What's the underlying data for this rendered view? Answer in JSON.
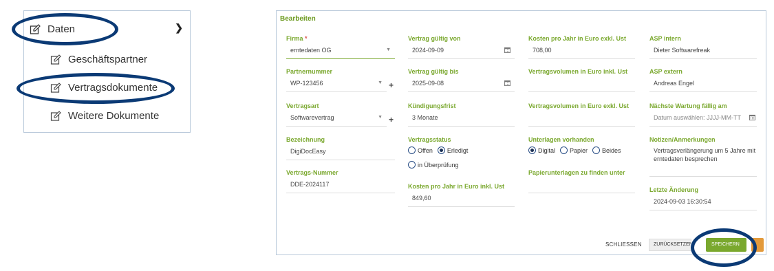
{
  "nav": {
    "top": "Daten",
    "items": [
      "Geschäftspartner",
      "Vertragsdokumente",
      "Weitere Dokumente"
    ]
  },
  "panel": {
    "title": "Bearbeiten",
    "col1": {
      "firma_label": "Firma",
      "firma_required": "*",
      "firma_value": "erntedaten OG",
      "partner_label": "Partnernummer",
      "partner_value": "WP-123456",
      "art_label": "Vertragsart",
      "art_value": "Softwarevertrag",
      "bez_label": "Bezeichnung",
      "bez_value": "DigiDocEasy",
      "nr_label": "Vertrags-Nummer",
      "nr_value": "DDE-2024117"
    },
    "col2": {
      "von_label": "Vertrag gültig von",
      "von_value": "2024-09-09",
      "bis_label": "Vertrag gültig bis",
      "bis_value": "2025-09-08",
      "kuend_label": "Kündigungsfrist",
      "kuend_value": "3 Monate",
      "status_label": "Vertragsstatus",
      "status_options": [
        "Offen",
        "Erledigt",
        "in Überprüfung"
      ],
      "status_selected": "Erledigt",
      "kosten_inkl_label": "Kosten pro Jahr in Euro inkl. Ust",
      "kosten_inkl_value": "849,60"
    },
    "col3": {
      "kosten_exkl_label": "Kosten pro Jahr in Euro exkl. Ust",
      "kosten_exkl_value": "708,00",
      "vol_inkl_label": "Vertragsvolumen in Euro inkl. Ust",
      "vol_exkl_label": "Vertragsvolumen in Euro exkl. Ust",
      "unterlagen_label": "Unterlagen vorhanden",
      "unterlagen_options": [
        "Digital",
        "Papier",
        "Beides"
      ],
      "unterlagen_selected": "Digital",
      "papier_label": "Papierunterlagen zu finden unter"
    },
    "col4": {
      "asp_intern_label": "ASP intern",
      "asp_intern_value": "Dieter Softwarefreak",
      "asp_extern_label": "ASP extern",
      "asp_extern_value": "Andreas Engel",
      "wartung_label": "Nächste Wartung fällig am",
      "wartung_placeholder": "Datum auswählen: JJJJ-MM-TT",
      "notizen_label": "Notizen/Anmerkungen",
      "notizen_value": "Vertragsverlängerung um 5 Jahre mit erntedaten besprechen",
      "aenderung_label": "Letzte Änderung",
      "aenderung_value": "2024-09-03 16:30:54"
    },
    "buttons": {
      "close": "SCHLIESSEN",
      "reset": "ZURÜCKSETZEN",
      "save": "SPEICHERN"
    }
  },
  "colors": {
    "accent_green": "#7aa82e",
    "highlight_ellipse": "#0b3a75",
    "orange": "#e39a3b"
  }
}
